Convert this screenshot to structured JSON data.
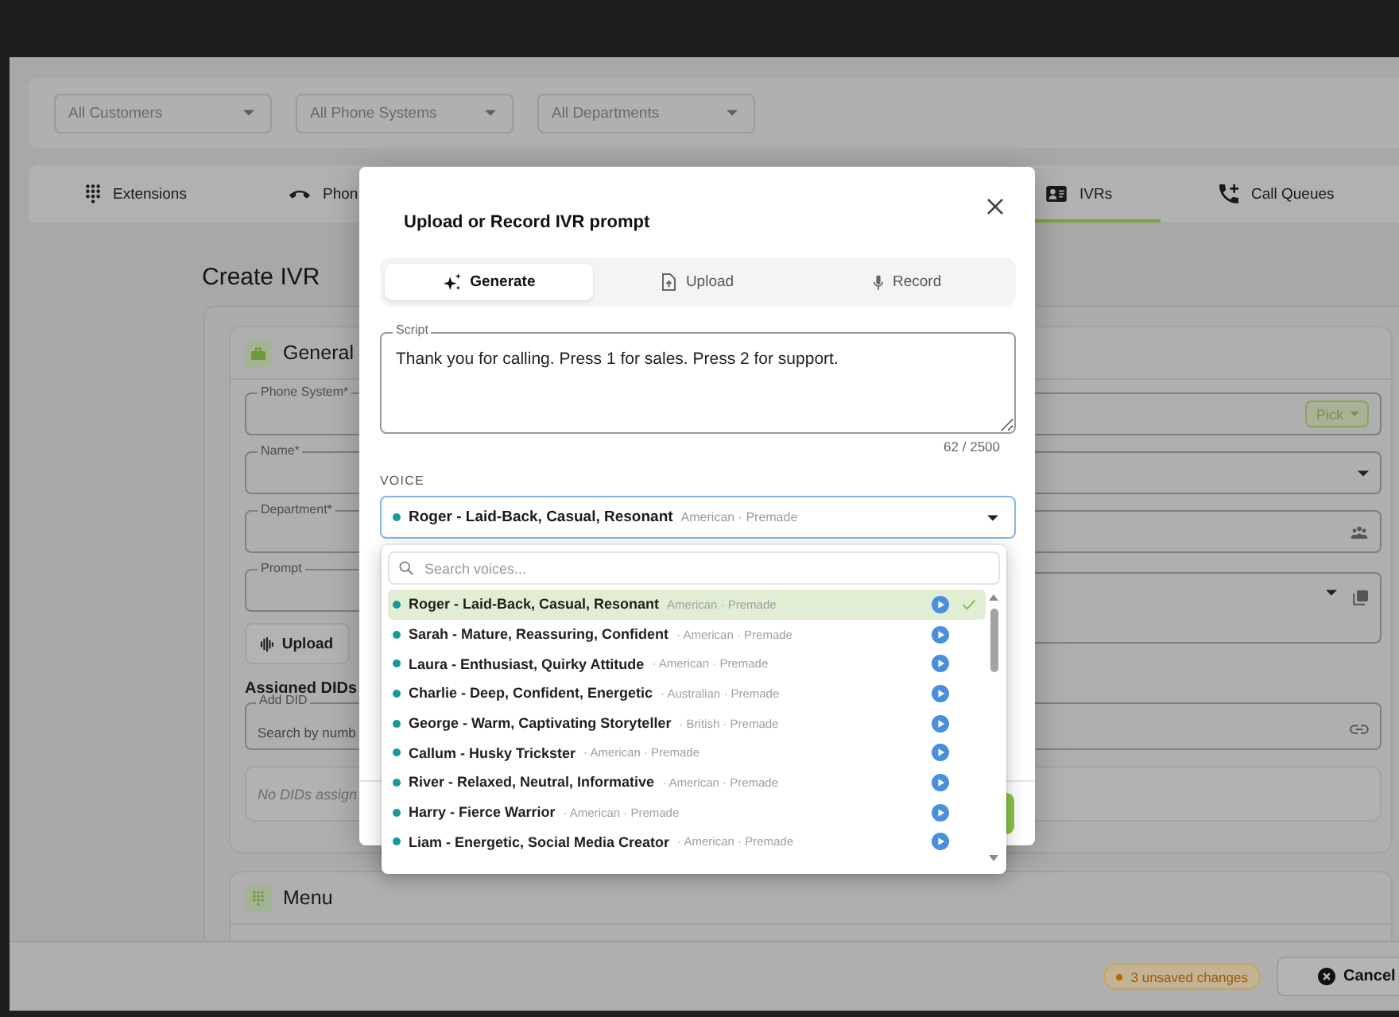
{
  "filters": [
    {
      "value": "All Customers"
    },
    {
      "value": "All Phone Systems"
    },
    {
      "value": "All Departments"
    }
  ],
  "tabs": [
    {
      "label": "Extensions",
      "selected": false
    },
    {
      "label": "Phon",
      "selected": false
    },
    {
      "label": "IVRs",
      "selected": true
    },
    {
      "label": "Call Queues",
      "selected": false
    }
  ],
  "page": {
    "heading": "Create IVR"
  },
  "general": {
    "title": "General",
    "fields": [
      {
        "kind": "pick",
        "label": "Phone System*",
        "chip": "Pick"
      },
      {
        "kind": "select",
        "label": "Name*"
      },
      {
        "kind": "people",
        "label": "Department*"
      },
      {
        "kind": "prompt",
        "label": "Prompt"
      }
    ],
    "upload_button": "Upload",
    "dids_heading": "Assigned DIDs",
    "add_did": {
      "label": "Add DID",
      "placeholder": "Search by numb"
    },
    "empty_note": "No DIDs assign"
  },
  "menu": {
    "title": "Menu"
  },
  "footer": {
    "unsaved": "3 unsaved changes",
    "cancel": "Cancel"
  },
  "modal": {
    "title": "Upload or Record IVR prompt",
    "modes": [
      {
        "label": "Generate",
        "selected": true
      },
      {
        "label": "Upload",
        "selected": false
      },
      {
        "label": "Record",
        "selected": false
      }
    ],
    "script": {
      "label": "Script",
      "value": "Thank you for calling. Press 1 for sales. Press 2 for support.",
      "counter": "62 / 2500"
    },
    "voice": {
      "label": "VOICE",
      "name": "Roger - Laid-Back, Casual, Resonant",
      "meta": "American · Premade"
    },
    "voice_menu": {
      "search_placeholder": "Search voices...",
      "voices": [
        {
          "name": "Roger - Laid-Back, Casual, Resonant",
          "meta": "American · Premade",
          "selected": true
        },
        {
          "name": "Sarah - Mature, Reassuring, Confident",
          "meta": "· American · Premade",
          "selected": false
        },
        {
          "name": "Laura - Enthusiast, Quirky Attitude",
          "meta": "· American · Premade",
          "selected": false
        },
        {
          "name": "Charlie - Deep, Confident, Energetic",
          "meta": "· Australian · Premade",
          "selected": false
        },
        {
          "name": "George - Warm, Captivating Storyteller",
          "meta": "· British · Premade",
          "selected": false
        },
        {
          "name": "Callum - Husky Trickster",
          "meta": "· American · Premade",
          "selected": false
        },
        {
          "name": "River - Relaxed, Neutral, Informative",
          "meta": "· American · Premade",
          "selected": false
        },
        {
          "name": "Harry - Fierce Warrior",
          "meta": "· American · Premade",
          "selected": false
        },
        {
          "name": "Liam - Energetic, Social Media Creator",
          "meta": "· American · Premade",
          "selected": false
        }
      ]
    }
  }
}
